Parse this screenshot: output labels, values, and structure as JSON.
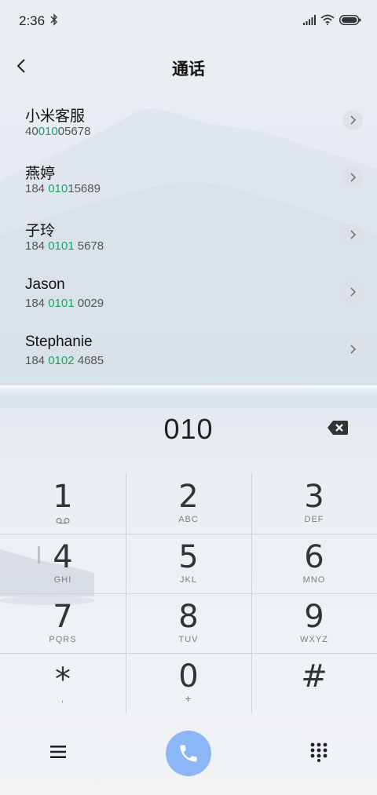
{
  "status": {
    "time": "2:36"
  },
  "header": {
    "title": "通话"
  },
  "contacts": [
    {
      "name": "小米客服",
      "number_pre": "40",
      "number_hl": "010",
      "number_post": "05678"
    },
    {
      "name": "燕婷",
      "number_pre": "184 ",
      "number_hl": "010",
      "number_post": "15689"
    },
    {
      "name": "子玲",
      "number_pre": "184 ",
      "number_hl": "0101",
      "number_post": " 5678"
    },
    {
      "name": "Jason",
      "number_pre": "184 ",
      "number_hl": "0101",
      "number_post": " 0029"
    },
    {
      "name": "Stephanie",
      "number_pre": "184 ",
      "number_hl": "0102",
      "number_post": " 4685"
    }
  ],
  "dialer": {
    "digits": "010"
  },
  "keys": [
    {
      "digit": "1",
      "sub": ""
    },
    {
      "digit": "2",
      "sub": "ABC"
    },
    {
      "digit": "3",
      "sub": "DEF"
    },
    {
      "digit": "4",
      "sub": "GHI"
    },
    {
      "digit": "5",
      "sub": "JKL"
    },
    {
      "digit": "6",
      "sub": "MNO"
    },
    {
      "digit": "7",
      "sub": "PQRS"
    },
    {
      "digit": "8",
      "sub": "TUV"
    },
    {
      "digit": "9",
      "sub": "WXYZ"
    },
    {
      "digit": "*",
      "sub": ","
    },
    {
      "digit": "0",
      "sub": "+"
    },
    {
      "digit": "#",
      "sub": ""
    }
  ],
  "colors": {
    "highlight": "#1aa565",
    "call_button": "#8bb6f8"
  },
  "icons": {
    "back": "back-arrow-icon",
    "detail": "chevron-right-icon",
    "backspace": "backspace-icon",
    "voicemail": "voicemail-icon",
    "menu": "menu-icon",
    "call": "phone-icon",
    "keypad": "dialpad-icon"
  }
}
